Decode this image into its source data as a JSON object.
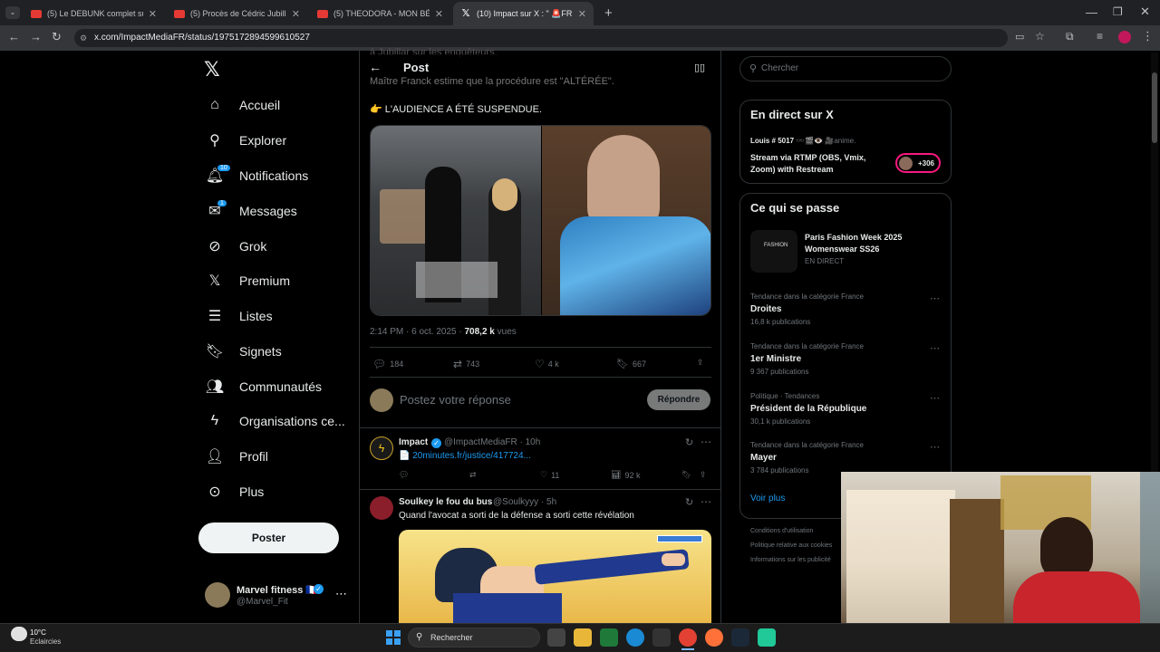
{
  "tabs": [
    {
      "title": "(5) Le DEBUNK complet sur la P",
      "active": false
    },
    {
      "title": "(5) Procès de Cédric Jubillar - Y",
      "active": false
    },
    {
      "title": "(5) THEODORA - MON BÉBÉ (F",
      "active": false
    },
    {
      "title": "(10) Impact sur X : \" 🚨FR ALERT",
      "active": true
    }
  ],
  "address": {
    "url": "x.com/ImpactMediaFR/status/1975172894599610527"
  },
  "sidebar": {
    "items": [
      {
        "label": "Accueil",
        "icon": "home-icon"
      },
      {
        "label": "Explorer",
        "icon": "search-icon"
      },
      {
        "label": "Notifications",
        "icon": "bell-icon",
        "badge": "10"
      },
      {
        "label": "Messages",
        "icon": "mail-icon",
        "badge": "1"
      },
      {
        "label": "Grok",
        "icon": "grok-icon"
      },
      {
        "label": "Premium",
        "icon": "x-logo-icon"
      },
      {
        "label": "Listes",
        "icon": "list-icon"
      },
      {
        "label": "Signets",
        "icon": "bookmark-icon"
      },
      {
        "label": "Communautés",
        "icon": "communities-icon"
      },
      {
        "label": "Organisations ce...",
        "icon": "lightning-icon"
      },
      {
        "label": "Profil",
        "icon": "person-icon"
      },
      {
        "label": "Plus",
        "icon": "more-circle-icon"
      }
    ],
    "post_button": "Poster",
    "account": {
      "name": "Marvel fitness 🇫🇷",
      "handle": "@Marvel_Fit"
    }
  },
  "header": {
    "title": "Post"
  },
  "tweet": {
    "line_cut": "à Jubillar sur les enquêteurs.",
    "line_partial": "Maître Franck estime que la procédure est \"ALTÉRÉE\".",
    "line_main": "👉 L'AUDIENCE A ÉTÉ SUSPENDUE.",
    "meta_time": "2:14 PM · 6 oct. 2025 · ",
    "meta_views": "708,2 k",
    "meta_views_label": " vues",
    "stats": {
      "replies": "184",
      "retweets": "743",
      "likes": "4 k",
      "bookmarks": "667"
    }
  },
  "reply_box": {
    "placeholder": "Postez votre réponse",
    "button": "Répondre"
  },
  "replies": [
    {
      "name": "Impact",
      "handle": "@ImpactMediaFR · 10h",
      "text": "📄 20minutes.fr/justice/417724...",
      "likes": "11",
      "views": "92 k"
    },
    {
      "name": "Soulkey le fou du bus",
      "handle": "@Soulkyyy · 5h",
      "text": "Quand l'avocat a sorti de la défense a sorti cette révélation"
    }
  ],
  "right": {
    "search_placeholder": "Chercher",
    "live": {
      "title": "En direct sur X",
      "host": "Louis # 5017 🕶️🎬👁️ 🎥",
      "host_suffix": "anime.",
      "stream": "Stream via RTMP (OBS, Vmix, Zoom) with Restream",
      "count": "+306"
    },
    "happening": {
      "title": "Ce qui se passe",
      "featured": {
        "title": "Paris Fashion Week 2025 Womenswear SS26",
        "meta": "EN DIRECT",
        "thumb": "FASHION"
      },
      "trends": [
        {
          "meta": "Tendance dans la catégorie France",
          "title": "Droites",
          "count": "16,8 k publications"
        },
        {
          "meta": "Tendance dans la catégorie France",
          "title": "1er Ministre",
          "count": "9 367 publications"
        },
        {
          "meta": "Politique · Tendances",
          "title": "Président de la République",
          "count": "30,1 k publications"
        },
        {
          "meta": "Tendance dans la catégorie France",
          "title": "Mayer",
          "count": "3 784 publications"
        }
      ],
      "see_more": "Voir plus"
    },
    "footer": [
      "Conditions d'utilisation",
      "Politique relative aux cookies",
      "Informations sur les publicité"
    ]
  },
  "taskbar": {
    "temp": "10°C",
    "weather": "Eclaircies",
    "search": "Rechercher"
  }
}
